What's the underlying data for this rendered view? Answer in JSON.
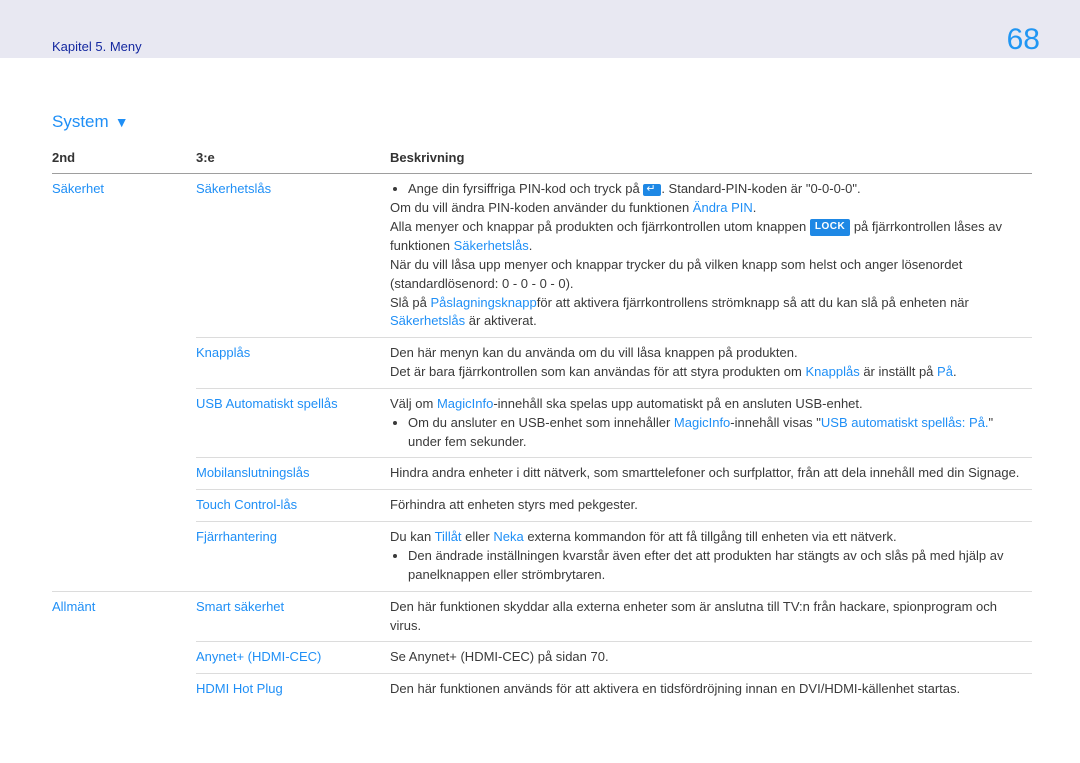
{
  "header": {
    "breadcrumb": "Kapitel 5. Meny",
    "page_number": "68"
  },
  "section": {
    "title": "System"
  },
  "table": {
    "headers": {
      "c1": "2nd",
      "c2": "3:e",
      "c3": "Beskrivning"
    },
    "groups": [
      {
        "lvl2": "Säkerhet",
        "items": [
          {
            "lvl3": "Säkerhetslås",
            "rows": [
              {
                "type": "bullets",
                "items": [
                  {
                    "parts": [
                      {
                        "t": "Ange din fyrsiffriga PIN-kod och tryck på "
                      },
                      {
                        "icon": "enter"
                      },
                      {
                        "t": ". Standard-PIN-koden är \"0-0-0-0\"."
                      }
                    ]
                  }
                ]
              },
              {
                "type": "line",
                "parts": [
                  {
                    "t": "Om du vill ändra PIN-koden använder du funktionen "
                  },
                  {
                    "kw": "Ändra PIN"
                  },
                  {
                    "t": "."
                  }
                ]
              },
              {
                "type": "line",
                "parts": [
                  {
                    "t": "Alla menyer och knappar på produkten och fjärrkontrollen utom knappen "
                  },
                  {
                    "badge": "LOCK"
                  },
                  {
                    "t": " på fjärrkontrollen låses av funktionen "
                  },
                  {
                    "kw": "Säkerhetslås"
                  },
                  {
                    "t": "."
                  }
                ]
              },
              {
                "type": "line",
                "parts": [
                  {
                    "t": "När du vill låsa upp menyer och knappar trycker du på vilken knapp som helst och anger lösenordet (standardlösenord: 0 - 0 - 0 - 0)."
                  }
                ]
              },
              {
                "type": "line",
                "parts": [
                  {
                    "t": "Slå på "
                  },
                  {
                    "kw": "Påslagningsknapp"
                  },
                  {
                    "t": "för att aktivera fjärrkontrollens strömknapp så att du kan slå på enheten när "
                  },
                  {
                    "kw": "Säkerhetslås"
                  },
                  {
                    "t": " är aktiverat."
                  }
                ]
              }
            ]
          },
          {
            "lvl3": "Knapplås",
            "rows": [
              {
                "type": "line",
                "parts": [
                  {
                    "t": "Den här menyn kan du använda om du vill låsa knappen på produkten."
                  }
                ]
              },
              {
                "type": "line",
                "parts": [
                  {
                    "t": "Det är bara fjärrkontrollen som kan användas för att styra produkten om "
                  },
                  {
                    "kw": "Knapplås"
                  },
                  {
                    "t": " är inställt på "
                  },
                  {
                    "kw": "På"
                  },
                  {
                    "t": "."
                  }
                ]
              }
            ]
          },
          {
            "lvl3": "USB Automatiskt spellås",
            "rows": [
              {
                "type": "line",
                "parts": [
                  {
                    "t": "Välj om "
                  },
                  {
                    "kw": "MagicInfo"
                  },
                  {
                    "t": "-innehåll ska spelas upp automatiskt på en ansluten USB-enhet."
                  }
                ]
              },
              {
                "type": "bullets",
                "items": [
                  {
                    "parts": [
                      {
                        "t": "Om du ansluter en USB-enhet som innehåller "
                      },
                      {
                        "kw": "MagicInfo"
                      },
                      {
                        "t": "-innehåll visas \""
                      },
                      {
                        "kw": "USB automatiskt spellås: På."
                      },
                      {
                        "t": "\" under fem sekunder."
                      }
                    ]
                  }
                ]
              }
            ]
          },
          {
            "lvl3": "Mobilanslutningslås",
            "rows": [
              {
                "type": "line",
                "parts": [
                  {
                    "t": "Hindra andra enheter i ditt nätverk, som smarttelefoner och surfplattor, från att dela innehåll med din Signage."
                  }
                ]
              }
            ]
          },
          {
            "lvl3": "Touch Control-lås",
            "rows": [
              {
                "type": "line",
                "parts": [
                  {
                    "t": "Förhindra att enheten styrs med pekgester."
                  }
                ]
              }
            ]
          },
          {
            "lvl3": "Fjärrhantering",
            "rows": [
              {
                "type": "line",
                "parts": [
                  {
                    "t": "Du kan "
                  },
                  {
                    "kw": "Tillåt"
                  },
                  {
                    "t": " eller "
                  },
                  {
                    "kw": "Neka"
                  },
                  {
                    "t": " externa kommandon för att få tillgång till enheten via ett nätverk."
                  }
                ]
              },
              {
                "type": "bullets",
                "items": [
                  {
                    "parts": [
                      {
                        "t": "Den ändrade inställningen kvarstår även efter det att produkten har stängts av och slås på med hjälp av panelknappen eller strömbrytaren."
                      }
                    ]
                  }
                ]
              }
            ]
          }
        ]
      },
      {
        "lvl2": "Allmänt",
        "items": [
          {
            "lvl3": "Smart säkerhet",
            "rows": [
              {
                "type": "line",
                "parts": [
                  {
                    "t": "Den här funktionen skyddar alla externa enheter som är anslutna till TV:n från hackare, spionprogram och virus."
                  }
                ]
              }
            ]
          },
          {
            "lvl3": "Anynet+ (HDMI-CEC)",
            "rows": [
              {
                "type": "line",
                "parts": [
                  {
                    "t": "Se Anynet+ (HDMI-CEC) på sidan 70."
                  }
                ]
              }
            ]
          },
          {
            "lvl3": "HDMI Hot Plug",
            "rows": [
              {
                "type": "line",
                "parts": [
                  {
                    "t": "Den här funktionen används för att aktivera en tidsfördröjning innan en DVI/HDMI-källenhet startas."
                  }
                ]
              }
            ]
          }
        ]
      }
    ]
  }
}
